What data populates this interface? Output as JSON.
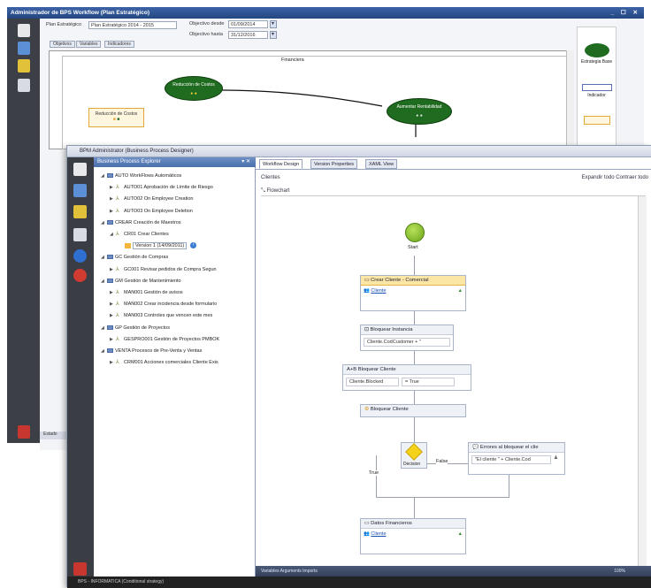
{
  "back": {
    "title": "Administrador de BPS Workflow (Plan Estratégico)",
    "window_buttons": "_ ☐ ✕",
    "field_label_1": "Plan Estratégico",
    "field_value_1": "Plan Estratégico 2014 - 2015",
    "date_label_1": "Objectivo desde",
    "date_value_1": "01/09/2014",
    "date_label_2": "Objectivo hasta",
    "date_value_2": "31/12/2016",
    "tabs": [
      "Objetivos",
      "Variables",
      "Indicadores"
    ],
    "canvas_title": "Financiera",
    "node_1": "Reducción de Costos",
    "node_2": "Aumentar Rentabilidad",
    "box_node": "Reducción de Costos",
    "palette_label_1": "Estrategia Base",
    "palette_label_2": "Indicador",
    "status": "Estado"
  },
  "front": {
    "title": "BPM Administrator (Business Process Designer)",
    "explorer": {
      "title": "Business Process Explorer",
      "pin": "▾ ✕",
      "items": [
        {
          "level": 0,
          "kind": "folder",
          "text": "AUTO  WorkFlows Automáticos"
        },
        {
          "level": 1,
          "kind": "wf",
          "text": "AUTO01  Aprobación de Límite de Riesgo"
        },
        {
          "level": 1,
          "kind": "wf",
          "text": "AUTO02  On Employee Creation"
        },
        {
          "level": 1,
          "kind": "wf",
          "text": "AUTO03  On Employee Deletion"
        },
        {
          "level": 0,
          "kind": "folder",
          "text": "CREAR  Creación de Maestros"
        },
        {
          "level": 1,
          "kind": "wf",
          "text": "CR01  Crear Clientes"
        },
        {
          "level": 2,
          "kind": "ver",
          "text": "Version 1 (14/09/2011)"
        },
        {
          "level": 0,
          "kind": "folder",
          "text": "GC  Gestión de Compras"
        },
        {
          "level": 1,
          "kind": "wf",
          "text": "GC001  Revisar pedidos de Compra Segun"
        },
        {
          "level": 0,
          "kind": "folder",
          "text": "GM  Gestión de Mantenimiento"
        },
        {
          "level": 1,
          "kind": "wf",
          "text": "MAN001  Gestión de avisos"
        },
        {
          "level": 1,
          "kind": "wf",
          "text": "MAN002  Crear incidencia desde formulario"
        },
        {
          "level": 1,
          "kind": "wf",
          "text": "MAN003  Controles que vencen este mes"
        },
        {
          "level": 0,
          "kind": "folder",
          "text": "GP  Gestión de Proyectos"
        },
        {
          "level": 1,
          "kind": "wf",
          "text": "GESPRO001  Gestión de Proyectos PMBOK"
        },
        {
          "level": 0,
          "kind": "folder",
          "text": "VENTA  Procesos de Pre-Venta y Ventas"
        },
        {
          "level": 1,
          "kind": "wf",
          "text": "CRM001  Acciones comerciales Cliente Exis"
        }
      ]
    },
    "designer": {
      "tabs": [
        "Workflow Design",
        "Version Properties",
        "XAML View"
      ],
      "breadcrumb": "Clientes",
      "links": "Expandir todo  Contraer todo",
      "flow_head": "Flowchart",
      "start": "Start",
      "act_1_title": "Crear Cliente - Comercial",
      "act_1_link": "Cliente",
      "act_2_title": "Bloquear Instancia",
      "act_2_field": "Cliente.CodCustomer + \"",
      "act_3_title": "Bloquear Cliente",
      "act_3_field_l": "Cliente.Blocked",
      "act_3_field_r": "= True",
      "act_4_title": "Bloquear Cliente",
      "decision": "Decision",
      "false_lbl": "False",
      "true_lbl": "True",
      "err_title": "Errores al bloquear el clie",
      "err_field": "\"El cliente \" + Cliente.Cod",
      "act_5_title": "Datos Financieros",
      "act_5_link": "Cliente"
    },
    "status": "Variables   Arguments   Imports",
    "zoom": "100%",
    "bottom": "BPS - INFORMATICA (Conditional strategy)"
  },
  "colors": {
    "green_node": "#1f6b1f",
    "accent_blue": "#4a6eaa",
    "yellow_header": "#fbe6a6"
  }
}
